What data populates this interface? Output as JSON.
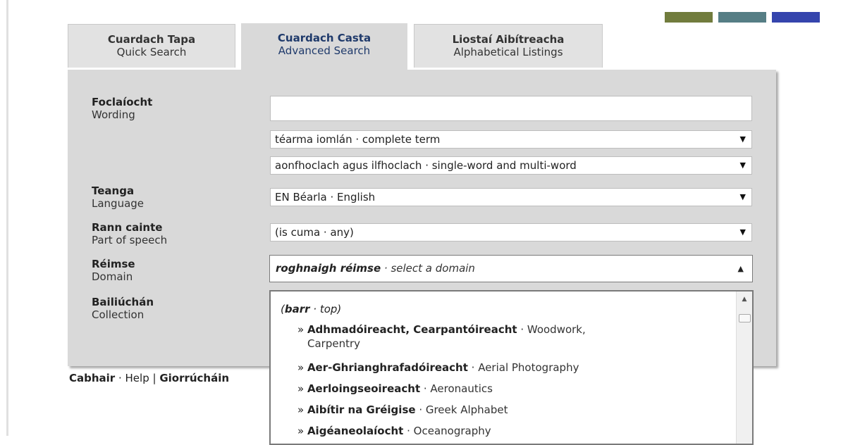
{
  "swatches": [
    {
      "color": "#717c3d"
    },
    {
      "color": "#567e85"
    },
    {
      "color": "#3545ad"
    }
  ],
  "tabs": [
    {
      "ga": "Cuardach Tapa",
      "en": "Quick Search",
      "active": false
    },
    {
      "ga": "Cuardach Casta",
      "en": "Advanced Search",
      "active": true
    },
    {
      "ga": "Liostaí Aibítreacha",
      "en": "Alphabetical Listings",
      "active": false
    }
  ],
  "form": {
    "wording": {
      "ga": "Foclaíocht",
      "en": "Wording",
      "value": ""
    },
    "match_type": {
      "value": "téarma iomlán · complete term"
    },
    "word_count": {
      "value": "aonfhoclach agus ilfhoclach · single-word and multi-word"
    },
    "language": {
      "ga": "Teanga",
      "en": "Language",
      "value": "EN Béarla · English"
    },
    "pos": {
      "ga": "Rann cainte",
      "en": "Part of speech",
      "value": "(is cuma · any)"
    },
    "domain": {
      "ga": "Réimse",
      "en": "Domain",
      "value_ga": "roghnaigh réimse",
      "value_en": " · select a domain"
    },
    "collection": {
      "ga": "Bailiúchán",
      "en": "Collection"
    }
  },
  "dropdown": {
    "top_ga": "barr",
    "top_en": " · top",
    "items": [
      {
        "ga": "Adhmadóireacht, Cearpantóireacht",
        "en": " · Woodwork,",
        "en2": "Carpentry"
      },
      {
        "ga": "Aer-Ghrianghrafadóireacht",
        "en": " · Aerial Photography"
      },
      {
        "ga": "Aerloingseoireacht",
        "en": " · Aeronautics"
      },
      {
        "ga": "Aibítir na Gréigise",
        "en": " · Greek Alphabet"
      },
      {
        "ga": "Aigéaneolaíocht",
        "en": " · Oceanography"
      }
    ]
  },
  "footer": {
    "help_ga": "Cabhair",
    "help_en": " · Help | ",
    "abbr_ga": "Giorrúcháin"
  }
}
